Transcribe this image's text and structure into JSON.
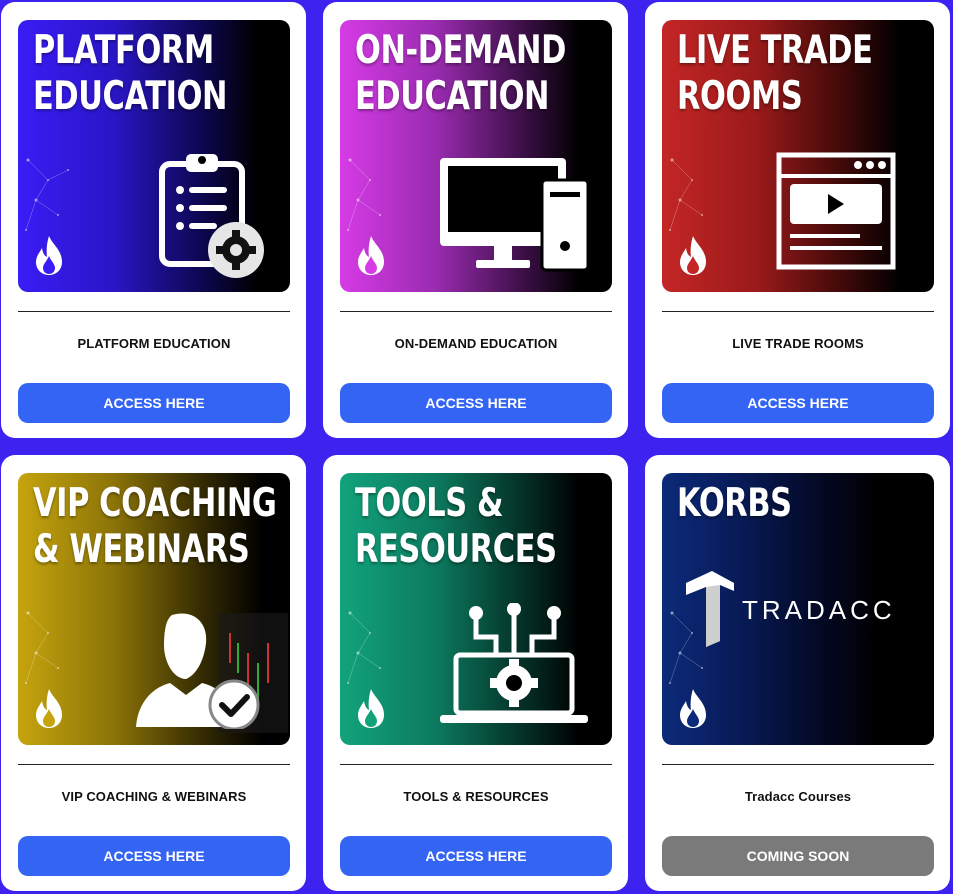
{
  "cards": [
    {
      "banner_lines": [
        "PLATFORM",
        "EDUCATION"
      ],
      "label": "PLATFORM EDUCATION",
      "button": "ACCESS HERE",
      "icon": "clipboard-gear-icon"
    },
    {
      "banner_lines": [
        "ON-DEMAND",
        "EDUCATION"
      ],
      "label": "ON-DEMAND EDUCATION",
      "button": "ACCESS HERE",
      "icon": "desktop-computer-icon"
    },
    {
      "banner_lines": [
        "LIVE TRADE",
        "ROOMS"
      ],
      "label": "LIVE TRADE ROOMS",
      "button": "ACCESS HERE",
      "icon": "video-player-icon"
    },
    {
      "banner_lines": [
        "VIP COACHING",
        "& WEBINARS"
      ],
      "label": "VIP COACHING & WEBINARS",
      "button": "ACCESS HERE",
      "icon": "user-check-icon"
    },
    {
      "banner_lines": [
        "TOOLS &",
        "RESOURCES"
      ],
      "label": "TOOLS & RESOURCES",
      "button": "ACCESS HERE",
      "icon": "laptop-gear-icon"
    },
    {
      "banner_lines": [
        "KORBS"
      ],
      "banner_logo_text": "TRADACC",
      "label": "Tradacc Courses",
      "button": "COMING SOON",
      "icon": "tradacc-logo"
    }
  ],
  "colors": {
    "page_background": "#3e22f0",
    "button_active": "#3464f4",
    "button_disabled": "#7a7a7a"
  }
}
